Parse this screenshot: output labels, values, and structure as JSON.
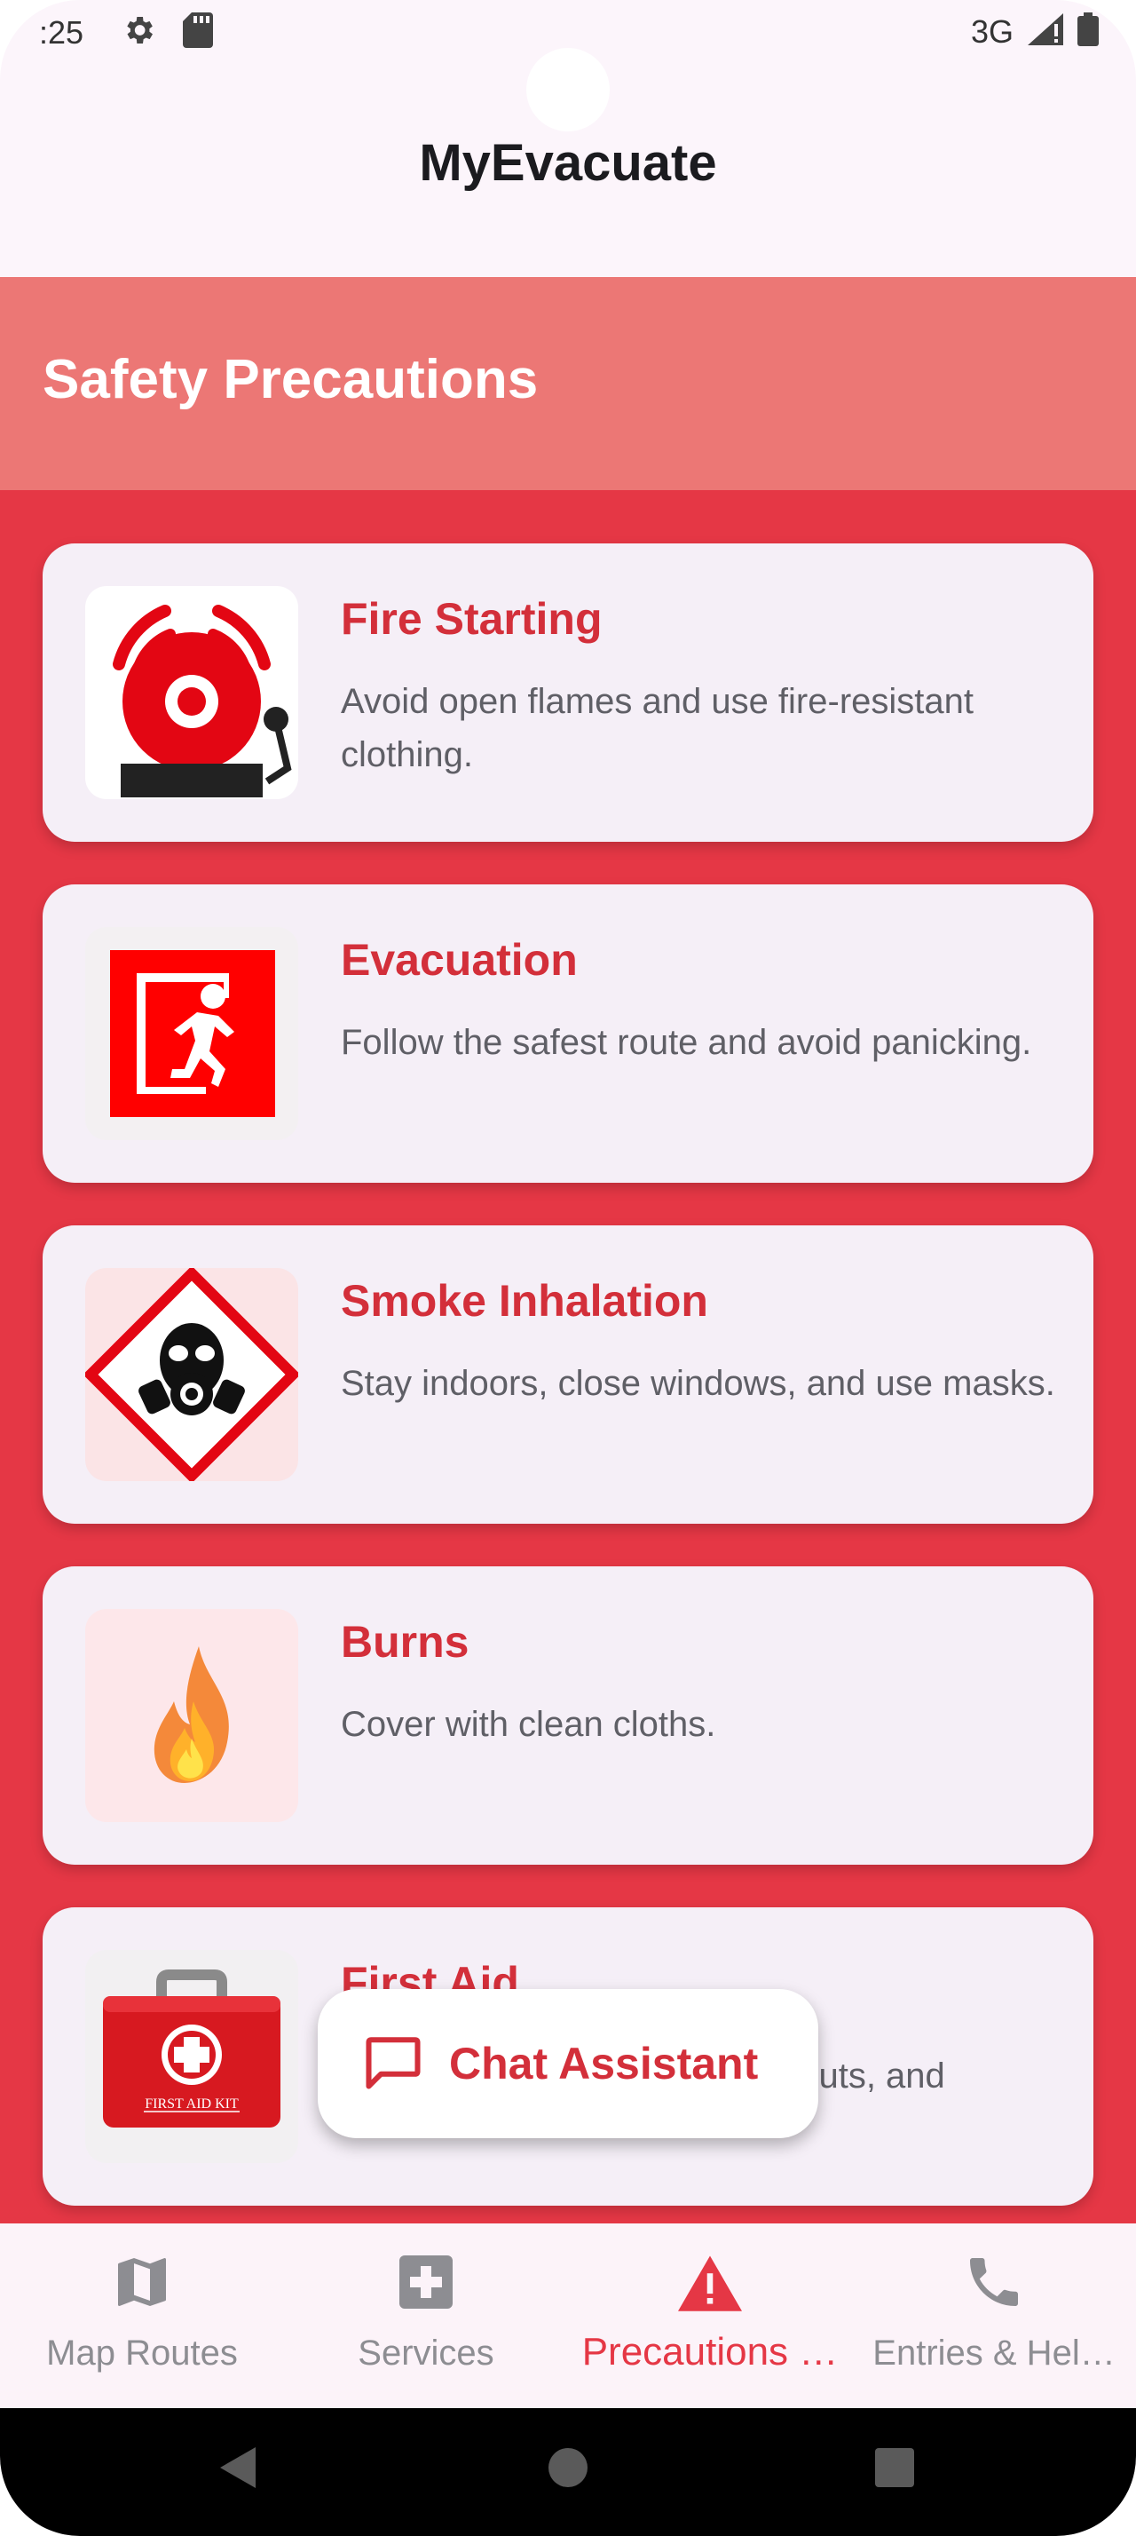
{
  "status_bar": {
    "time": ":25",
    "network": "3G",
    "icons": [
      "gear-icon",
      "sd-card-icon",
      "signal-icon",
      "battery-icon"
    ]
  },
  "app_bar": {
    "title": "MyEvacuate"
  },
  "section": {
    "title": "Safety Precautions"
  },
  "precautions": [
    {
      "title": "Fire Starting",
      "description": "Avoid open flames and use fire-resistant clothing.",
      "icon": "fire-alarm-bell-icon"
    },
    {
      "title": "Evacuation",
      "description": "Follow the safest route and avoid panicking.",
      "icon": "emergency-exit-icon"
    },
    {
      "title": "Smoke Inhalation",
      "description": "Stay indoors, close windows, and use masks.",
      "icon": "gas-mask-icon"
    },
    {
      "title": "Burns",
      "description": "Cover with clean cloths.",
      "icon": "flame-icon"
    },
    {
      "title": "First Aid",
      "description": "ns, cuts, and",
      "icon": "first-aid-kit-icon",
      "icon_text": "FIRST AID KIT"
    }
  ],
  "fab": {
    "label": "Chat Assistant",
    "icon": "chat-bubble-icon"
  },
  "bottom_nav": {
    "items": [
      {
        "label": "Map Routes",
        "icon": "map-icon",
        "active": false
      },
      {
        "label": "Services",
        "icon": "medical-cross-icon",
        "active": false
      },
      {
        "label": "Precautions …",
        "icon": "warning-icon",
        "active": true
      },
      {
        "label": "Entries & Hel…",
        "icon": "phone-icon",
        "active": false
      }
    ]
  },
  "colors": {
    "accent": "#e53745",
    "header_band": "#ec7775",
    "card_bg": "#f5eff7",
    "title_red": "#d32f3a",
    "inactive_nav": "#8d8d92"
  }
}
